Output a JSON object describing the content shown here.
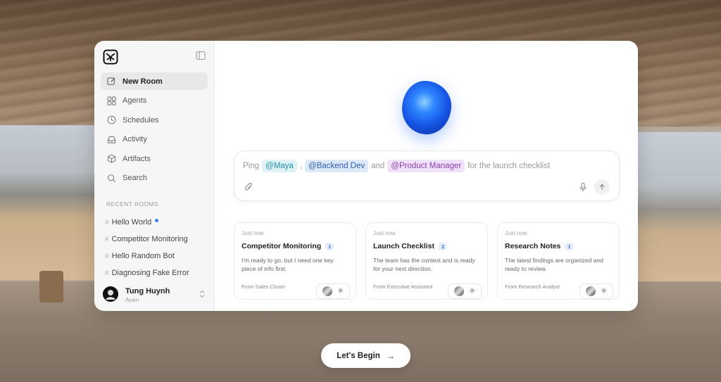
{
  "sidebar": {
    "nav": [
      {
        "label": "New Room",
        "icon": "edit-icon",
        "active": true
      },
      {
        "label": "Agents",
        "icon": "grid-icon"
      },
      {
        "label": "Schedules",
        "icon": "clock-icon"
      },
      {
        "label": "Activity",
        "icon": "inbox-icon"
      },
      {
        "label": "Artifacts",
        "icon": "cube-icon"
      },
      {
        "label": "Search",
        "icon": "search-icon"
      }
    ],
    "recent_title": "RECENT ROOMS",
    "recent": [
      {
        "label": "Hello World",
        "unread": true
      },
      {
        "label": "Competitor Monitoring"
      },
      {
        "label": "Hello Random Bot"
      },
      {
        "label": "Diagnosing Fake Error"
      }
    ],
    "user": {
      "name": "Tung Huynh",
      "org": "Acen"
    }
  },
  "composer": {
    "prefix": "Ping",
    "mention1": "@Maya",
    "sep1": ",",
    "mention2": "@Backend Dev",
    "sep2": "and",
    "mention3": "@Product Manager",
    "suffix": "for the launch checklist"
  },
  "cards": [
    {
      "time": "Just now",
      "title": "Competitor Monitoring",
      "count": "1",
      "body": "I'm ready to go, but I need one key piece of info first.",
      "from": "From Sales Closer"
    },
    {
      "time": "Just now",
      "title": "Launch Checklist",
      "count": "2",
      "body": "The team has the context and is ready for your next direction.",
      "from": "From Executive Assistant"
    },
    {
      "time": "Just now",
      "title": "Research Notes",
      "count": "1",
      "body": "The latest findings are organized and ready to review.",
      "from": "From Research Analyst"
    }
  ],
  "cta": {
    "label": "Let's Begin"
  },
  "colors": {
    "accent": "#3b82f6",
    "orb": "#1656e6"
  }
}
